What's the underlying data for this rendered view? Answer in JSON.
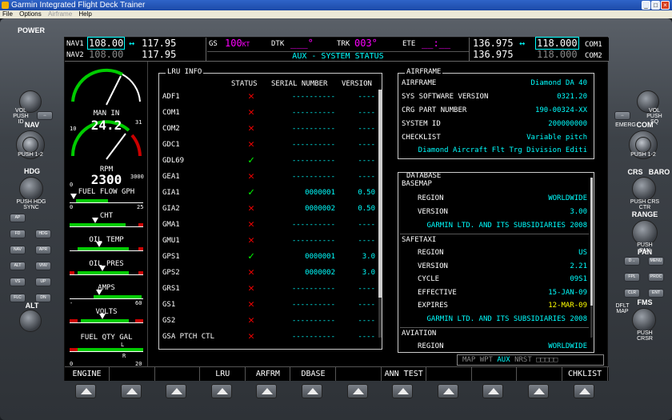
{
  "window": {
    "title": "Garmin Integrated Flight Deck Trainer",
    "menus": [
      {
        "label": "File",
        "enabled": true
      },
      {
        "label": "Options",
        "enabled": true
      },
      {
        "label": "Airframe",
        "enabled": false
      },
      {
        "label": "Help",
        "enabled": true
      }
    ]
  },
  "bezel": {
    "left_labels": {
      "power": "POWER",
      "vol": "VOL PUSH ID",
      "nav": "NAV",
      "push12": "PUSH 1-2",
      "hdg": "HDG",
      "hdg_push": "PUSH HDG SYNC",
      "alt": "ALT"
    },
    "left_buttons": [
      [
        "AP"
      ],
      [
        "FD",
        "HDG"
      ],
      [
        "NAV",
        "APR"
      ],
      [
        "ALT",
        "VNV"
      ],
      [
        "VS",
        "UP"
      ],
      [
        "FLC",
        "DN"
      ]
    ],
    "right_labels": {
      "com": "COM",
      "push12": "PUSH 1-2",
      "emerg": "EMERG",
      "crs": "CRS",
      "baro": "BARO",
      "crs_push": "PUSH CRS CTR",
      "range": "RANGE",
      "pan": "PAN",
      "pan_push": "PUSH PAN",
      "fms": "FMS",
      "fms_push": "PUSH CRSR",
      "dflt": "DFLT MAP",
      "vol": "VOL PUSH SQ"
    },
    "right_buttons": [
      [
        "D→",
        "MENU"
      ],
      [
        "FPL",
        "PROC"
      ],
      [
        "CLR",
        "ENT"
      ]
    ]
  },
  "top_bar": {
    "nav1_label": "NAV1",
    "nav1_active": "108.00",
    "nav1_standby": "117.95",
    "nav2_label": "NAV2",
    "nav2_active": "108.00",
    "nav2_standby": "117.95",
    "swap_arrow": "↔",
    "gs_label": "GS",
    "gs_value": "100",
    "gs_unit": "KT",
    "dtk_label": "DTK",
    "dtk_value": "___°",
    "trk_label": "TRK",
    "trk_value": "003°",
    "ete_label": "ETE",
    "ete_value": "__:__",
    "com1_active": "136.975",
    "com1_standby": "118.000",
    "com1_label": "COM1",
    "com2_active": "136.975",
    "com2_standby": "118.000",
    "com2_label": "COM2",
    "page_title": "AUX - SYSTEM STATUS"
  },
  "eis": {
    "man_label": "MAN IN",
    "man_value": "24.2",
    "man_scale_min": "10",
    "man_scale_max": "31",
    "rpm_label": "RPM",
    "rpm_value": "2300",
    "rpm_scale_min": "0",
    "rpm_scale_max": "3000",
    "fuel_flow_label": "FUEL FLOW GPH",
    "fuel_flow_min": "0",
    "fuel_flow_max": "25",
    "cht_label": "CHT",
    "oil_temp_label": "OIL TEMP",
    "oil_pres_label": "OIL PRES",
    "amps_label": "AMPS",
    "amps_min": "-",
    "amps_max": "60",
    "volts_label": "VOLTS",
    "fuel_qty_label": "FUEL QTY GAL",
    "fuel_qty_min": "0",
    "fuel_qty_max": "20",
    "fuel_left": "L",
    "fuel_right": "R",
    "levels": {
      "fuel_flow": 0.05,
      "cht": 0.35,
      "oil_temp": 0.4,
      "oil_pres": 0.45,
      "amps": 0.4,
      "volts": 0.45
    }
  },
  "lru": {
    "title": "LRU INFO",
    "headers": {
      "status": "STATUS",
      "serial": "SERIAL NUMBER",
      "version": "VERSION"
    },
    "rows": [
      {
        "name": "ADF1",
        "ok": false,
        "serial": "----------",
        "version": "----"
      },
      {
        "name": "COM1",
        "ok": false,
        "serial": "----------",
        "version": "----"
      },
      {
        "name": "COM2",
        "ok": false,
        "serial": "----------",
        "version": "----"
      },
      {
        "name": "GDC1",
        "ok": false,
        "serial": "----------",
        "version": "----"
      },
      {
        "name": "GDL69",
        "ok": true,
        "serial": "----------",
        "version": "----"
      },
      {
        "name": "GEA1",
        "ok": false,
        "serial": "----------",
        "version": "----"
      },
      {
        "name": "GIA1",
        "ok": true,
        "serial": "0000001",
        "version": "0.50"
      },
      {
        "name": "GIA2",
        "ok": false,
        "serial": "0000002",
        "version": "0.50"
      },
      {
        "name": "GMA1",
        "ok": false,
        "serial": "----------",
        "version": "----"
      },
      {
        "name": "GMU1",
        "ok": false,
        "serial": "----------",
        "version": "----"
      },
      {
        "name": "GPS1",
        "ok": true,
        "serial": "0000001",
        "version": "3.0"
      },
      {
        "name": "GPS2",
        "ok": false,
        "serial": "0000002",
        "version": "3.0"
      },
      {
        "name": "GRS1",
        "ok": false,
        "serial": "----------",
        "version": "----"
      },
      {
        "name": "GS1",
        "ok": false,
        "serial": "----------",
        "version": "----"
      },
      {
        "name": "GS2",
        "ok": false,
        "serial": "----------",
        "version": "----"
      },
      {
        "name": "GSA PTCH CTL",
        "ok": false,
        "serial": "----------",
        "version": "----"
      }
    ]
  },
  "airframe": {
    "title": "AIRFRAME",
    "rows": [
      {
        "key": "AIRFRAME",
        "value": "Diamond DA 40"
      },
      {
        "key": "SYS SOFTWARE VERSION",
        "value": "0321.20"
      },
      {
        "key": "CRG PART NUMBER",
        "value": "190-00324-XX"
      },
      {
        "key": "SYSTEM ID",
        "value": "200000000"
      },
      {
        "key": "CHECKLIST",
        "value": "Variable pitch"
      }
    ],
    "checklist_desc": "Diamond Aircraft Flt Trg Division Editi"
  },
  "database": {
    "title": "DATABASE",
    "basemap": {
      "label": "BASEMAP",
      "region_k": "REGION",
      "region": "WORLDWIDE",
      "version_k": "VERSION",
      "version": "3.00",
      "owner": "GARMIN LTD. AND ITS SUBSIDIARIES 2008"
    },
    "safetaxi": {
      "label": "SAFETAXI",
      "region_k": "REGION",
      "region": "US",
      "version_k": "VERSION",
      "version": "2.21",
      "cycle_k": "CYCLE",
      "cycle": "09S1",
      "effective_k": "EFFECTIVE",
      "effective": "15-JAN-09",
      "expires_k": "EXPIRES",
      "expires": "12-MAR-09",
      "owner": "GARMIN LTD. AND ITS SUBSIDIARIES 2008"
    },
    "aviation": {
      "label": "AVIATION",
      "region_k": "REGION",
      "region": "WORLDWIDE"
    }
  },
  "page_group": {
    "items": [
      "MAP",
      "WPT",
      "AUX",
      "NRST"
    ],
    "active": "AUX",
    "boxes": "□□□□□"
  },
  "softkeys": [
    "ENGINE",
    "",
    "",
    "LRU",
    "ARFRM",
    "DBASE",
    "",
    "ANN TEST",
    "",
    "",
    "",
    "CHKLIST"
  ]
}
